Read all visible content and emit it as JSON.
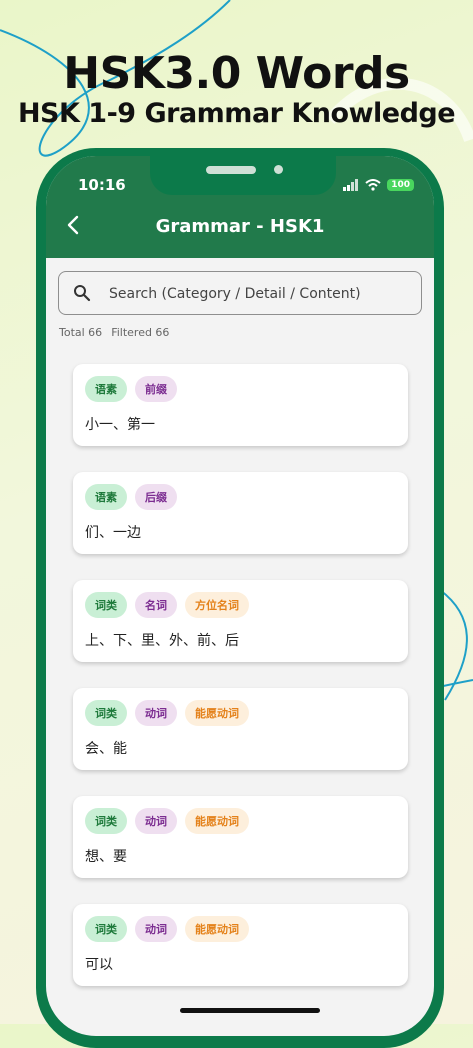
{
  "promo": {
    "title": "HSK3.0 Words",
    "subtitle": "HSK 1-9 Grammar Knowledge"
  },
  "status_bar": {
    "time": "10:16",
    "battery": "100"
  },
  "app_bar": {
    "title": "Grammar - HSK1"
  },
  "search": {
    "placeholder": "Search (Category / Detail / Content)"
  },
  "counts": {
    "total": "Total 66",
    "filtered": "Filtered 66"
  },
  "cards": [
    {
      "tags": [
        {
          "label": "语素",
          "color": "green"
        },
        {
          "label": "前缀",
          "color": "purple"
        }
      ],
      "text": "小一、第一"
    },
    {
      "tags": [
        {
          "label": "语素",
          "color": "green"
        },
        {
          "label": "后缀",
          "color": "purple"
        }
      ],
      "text": "们、一边"
    },
    {
      "tags": [
        {
          "label": "词类",
          "color": "green"
        },
        {
          "label": "名词",
          "color": "purple"
        },
        {
          "label": "方位名词",
          "color": "orange"
        }
      ],
      "text": "上、下、里、外、前、后"
    },
    {
      "tags": [
        {
          "label": "词类",
          "color": "green"
        },
        {
          "label": "动词",
          "color": "purple"
        },
        {
          "label": "能愿动词",
          "color": "orange"
        }
      ],
      "text": "会、能"
    },
    {
      "tags": [
        {
          "label": "词类",
          "color": "green"
        },
        {
          "label": "动词",
          "color": "purple"
        },
        {
          "label": "能愿动词",
          "color": "orange"
        }
      ],
      "text": "想、要"
    },
    {
      "tags": [
        {
          "label": "词类",
          "color": "green"
        },
        {
          "label": "动词",
          "color": "purple"
        },
        {
          "label": "能愿动词",
          "color": "orange"
        }
      ],
      "text": "可以"
    }
  ],
  "colors": {
    "phone_frame": "#0c7a4a",
    "app_bar": "#217a4b",
    "tag_green": "#c9efd5",
    "tag_purple": "#efdff0",
    "tag_orange": "#fdefdc"
  },
  "icons": {
    "back": "back-arrow-icon",
    "search": "search-icon",
    "signal": "signal-icon",
    "wifi": "wifi-icon"
  }
}
